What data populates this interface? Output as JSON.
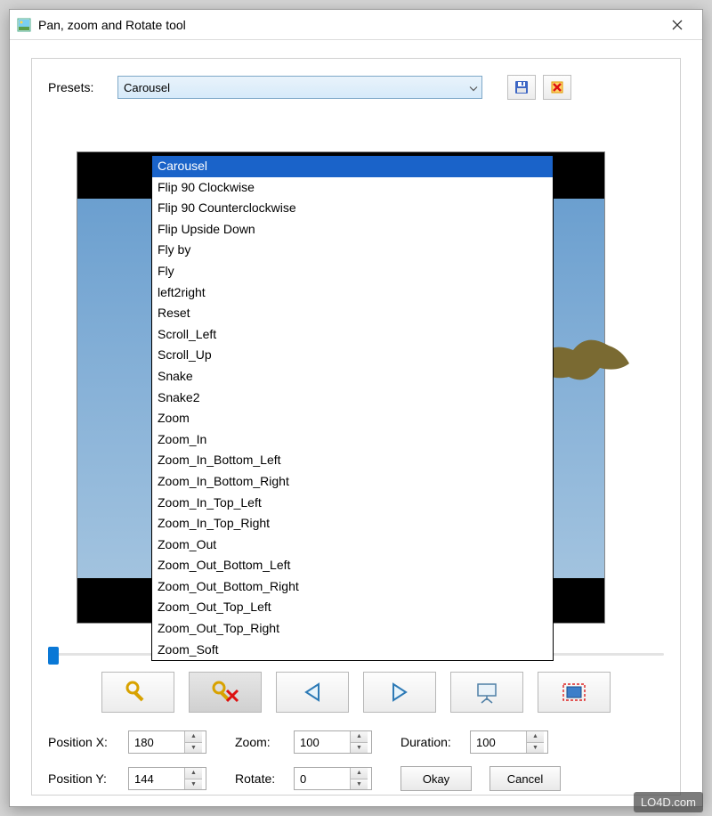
{
  "window": {
    "title": "Pan, zoom and Rotate tool"
  },
  "presets": {
    "label": "Presets:",
    "selected": "Carousel",
    "options": [
      "Carousel",
      "Flip 90 Clockwise",
      "Flip 90 Counterclockwise",
      "Flip Upside Down",
      "Fly by",
      "Fly",
      "left2right",
      "Reset",
      "Scroll_Left",
      "Scroll_Up",
      "Snake",
      "Snake2",
      "Zoom",
      "Zoom_In",
      "Zoom_In_Bottom_Left",
      "Zoom_In_Bottom_Right",
      "Zoom_In_Top_Left",
      "Zoom_In_Top_Right",
      "Zoom_Out",
      "Zoom_Out_Bottom_Left",
      "Zoom_Out_Bottom_Right",
      "Zoom_Out_Top_Left",
      "Zoom_Out_Top_Right",
      "Zoom_Soft"
    ]
  },
  "icons": {
    "save": "save-icon",
    "delete": "delete-icon",
    "key_add": "key-add-icon",
    "key_remove": "key-remove-icon",
    "prev": "prev-icon",
    "next": "next-icon",
    "present": "present-icon",
    "screen": "screen-icon"
  },
  "fields": {
    "posx_label": "Position X:",
    "posx_value": "180",
    "posy_label": "Position Y:",
    "posy_value": "144",
    "zoom_label": "Zoom:",
    "zoom_value": "100",
    "rotate_label": "Rotate:",
    "rotate_value": "0",
    "duration_label": "Duration:",
    "duration_value": "100"
  },
  "buttons": {
    "okay": "Okay",
    "cancel": "Cancel"
  },
  "watermark": "LO4D.com"
}
